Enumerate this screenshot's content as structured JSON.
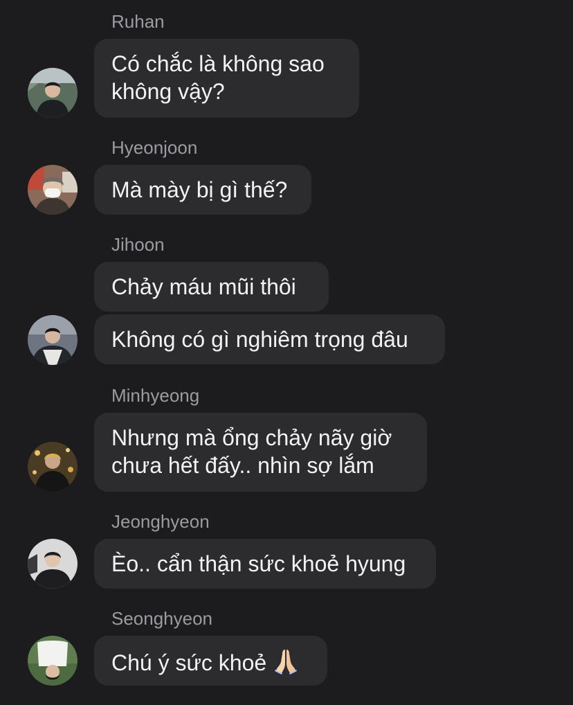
{
  "messages": [
    {
      "sender": "Ruhan",
      "lines": [
        "Có chắc là không sao",
        "không vậy?"
      ]
    },
    {
      "sender": "Hyeonjoon",
      "lines": [
        "Mà mày bị gì thế?"
      ]
    },
    {
      "sender": "Jihoon",
      "lines": [
        "Chảy máu mũi thôi"
      ]
    },
    {
      "sender": "",
      "lines": [
        "Không có gì nghiêm trọng đâu"
      ]
    },
    {
      "sender": "Minhyeong",
      "lines": [
        "Nhưng mà ổng chảy nãy giờ",
        "chưa hết đấy.. nhìn sợ lắm"
      ]
    },
    {
      "sender": "Jeonghyeon",
      "lines": [
        "Èo.. cẩn thận sức khoẻ hyung"
      ]
    },
    {
      "sender": "Seonghyeon",
      "lines": [
        "Chú ý sức khoẻ"
      ]
    }
  ],
  "icons": {
    "praying_hands": "praying-hands-emoji"
  },
  "colors": {
    "background": "#1c1c1e",
    "bubble": "#2c2c2e",
    "text": "#f2f2f7",
    "sender_name": "#9b9ba1"
  }
}
